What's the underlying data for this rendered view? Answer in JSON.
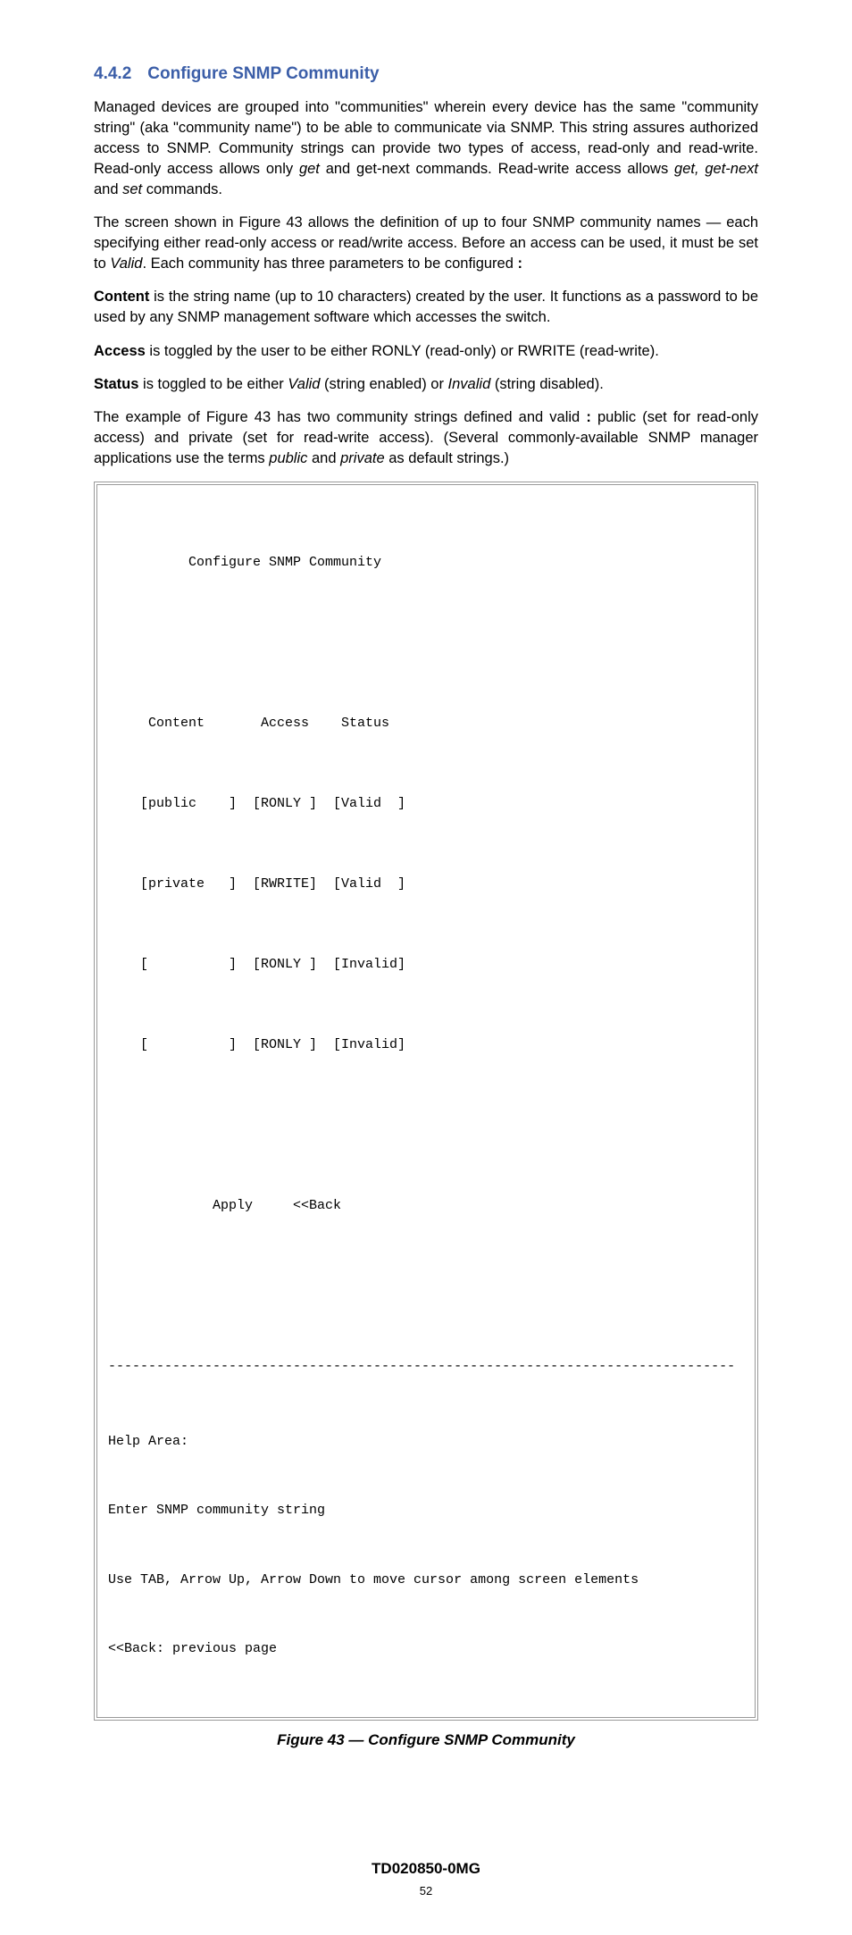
{
  "heading": {
    "number": "4.4.2",
    "title": "Configure SNMP Community"
  },
  "para1_a": "Managed devices are grouped into \"communities\" wherein every device has the same \"community string\" (aka \"community name\") to be able to communicate via SNMP.  This string assures authorized access to SNMP.  Community strings can provide two types of access, read-only and read-write.  Read-only access allows only ",
  "para1_b": "get",
  "para1_c": " and get-next commands. Read-write access allows ",
  "para1_d": "get, get-next",
  "para1_e": " and ",
  "para1_f": "set",
  "para1_g": " commands.",
  "para2_a": "The screen shown in Figure 43 allows the definition of up to four SNMP community names — each specifying either read-only access or read/write access.  Before an access can be used, it must be set to ",
  "para2_b": "Valid",
  "para2_c": ".  Each community has three parameters to be configured ",
  "para2_d": ":",
  "para3_a": "Content",
  "para3_b": " is the string name (up to 10 characters) created by the user.  It functions as a password to be used by any SNMP management software which accesses the switch.",
  "para4_a": "Access",
  "para4_b": " is toggled by the user to be either RONLY (read-only) or RWRITE (read-write).",
  "para5_a": "Status",
  "para5_b": " is toggled to be either ",
  "para5_c": "Valid",
  "para5_d": " (string enabled) or ",
  "para5_e": "Invalid",
  "para5_f": " (string disabled).",
  "para6_a": "The example of Figure 43 has two community strings defined and valid ",
  "para6_b": ":",
  "para6_c": "   public (set for read-only access) and private (set for read-write access).  (Several commonly-available SNMP manager applications use the terms ",
  "para6_d": "public",
  "para6_e": " and ",
  "para6_f": "private",
  "para6_g": " as default strings.)",
  "terminal": {
    "title": "          Configure SNMP Community",
    "header": "     Content       Access    Status",
    "rows": [
      "    [public    ]  [RONLY ]  [Valid  ]",
      "    [private   ]  [RWRITE]  [Valid  ]",
      "    [          ]  [RONLY ]  [Invalid]",
      "    [          ]  [RONLY ]  [Invalid]"
    ],
    "actions": "             Apply     <<Back",
    "help_title": "Help Area:",
    "help1": "Enter SNMP community string",
    "help2": "Use TAB, Arrow Up, Arrow Down to move cursor among screen elements",
    "help3": "<<Back: previous page",
    "divider": "------------------------------------------------------------------------------"
  },
  "figure_caption": "Figure 43 — Configure SNMP Community",
  "doc_id": "TD020850-0MG",
  "page_number": "52"
}
